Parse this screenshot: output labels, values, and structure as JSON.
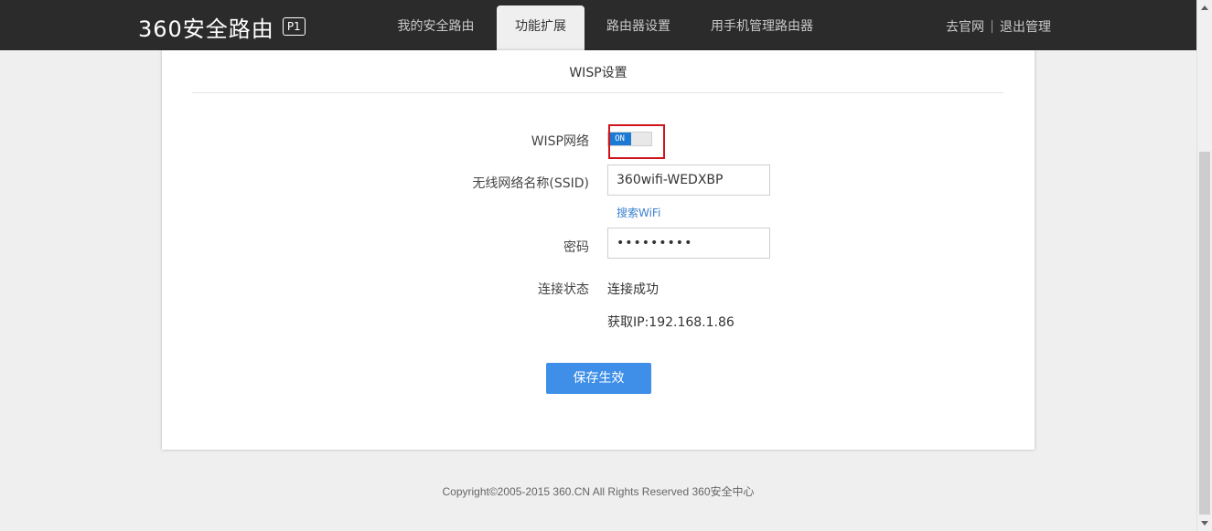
{
  "header": {
    "logo_text": "360安全路由",
    "logo_badge": "P1",
    "tabs": [
      {
        "label": "我的安全路由"
      },
      {
        "label": "功能扩展"
      },
      {
        "label": "路由器设置"
      },
      {
        "label": "用手机管理路由器"
      }
    ],
    "links": {
      "official_site": "去官网",
      "logout": "退出管理"
    }
  },
  "wisp": {
    "title": "WISP设置",
    "network_label": "WISP网络",
    "toggle_state": "ON",
    "ssid_label": "无线网络名称(SSID)",
    "ssid_value": "360wifi-WEDXBP",
    "search_wifi": "搜索WiFi",
    "password_label": "密码",
    "password_value": "•••••••••",
    "status_label": "连接状态",
    "status_value": "连接成功",
    "ip_text": "获取IP:192.168.1.86",
    "save_label": "保存生效"
  },
  "footer": {
    "copyright": "Copyright©2005-2015 360.CN All Rights Reserved 360安全中心"
  },
  "colors": {
    "topbar": "#2b2b2b",
    "accent": "#3f8fe8",
    "toggle_on": "#1a7ad4",
    "highlight": "#d0141b"
  }
}
